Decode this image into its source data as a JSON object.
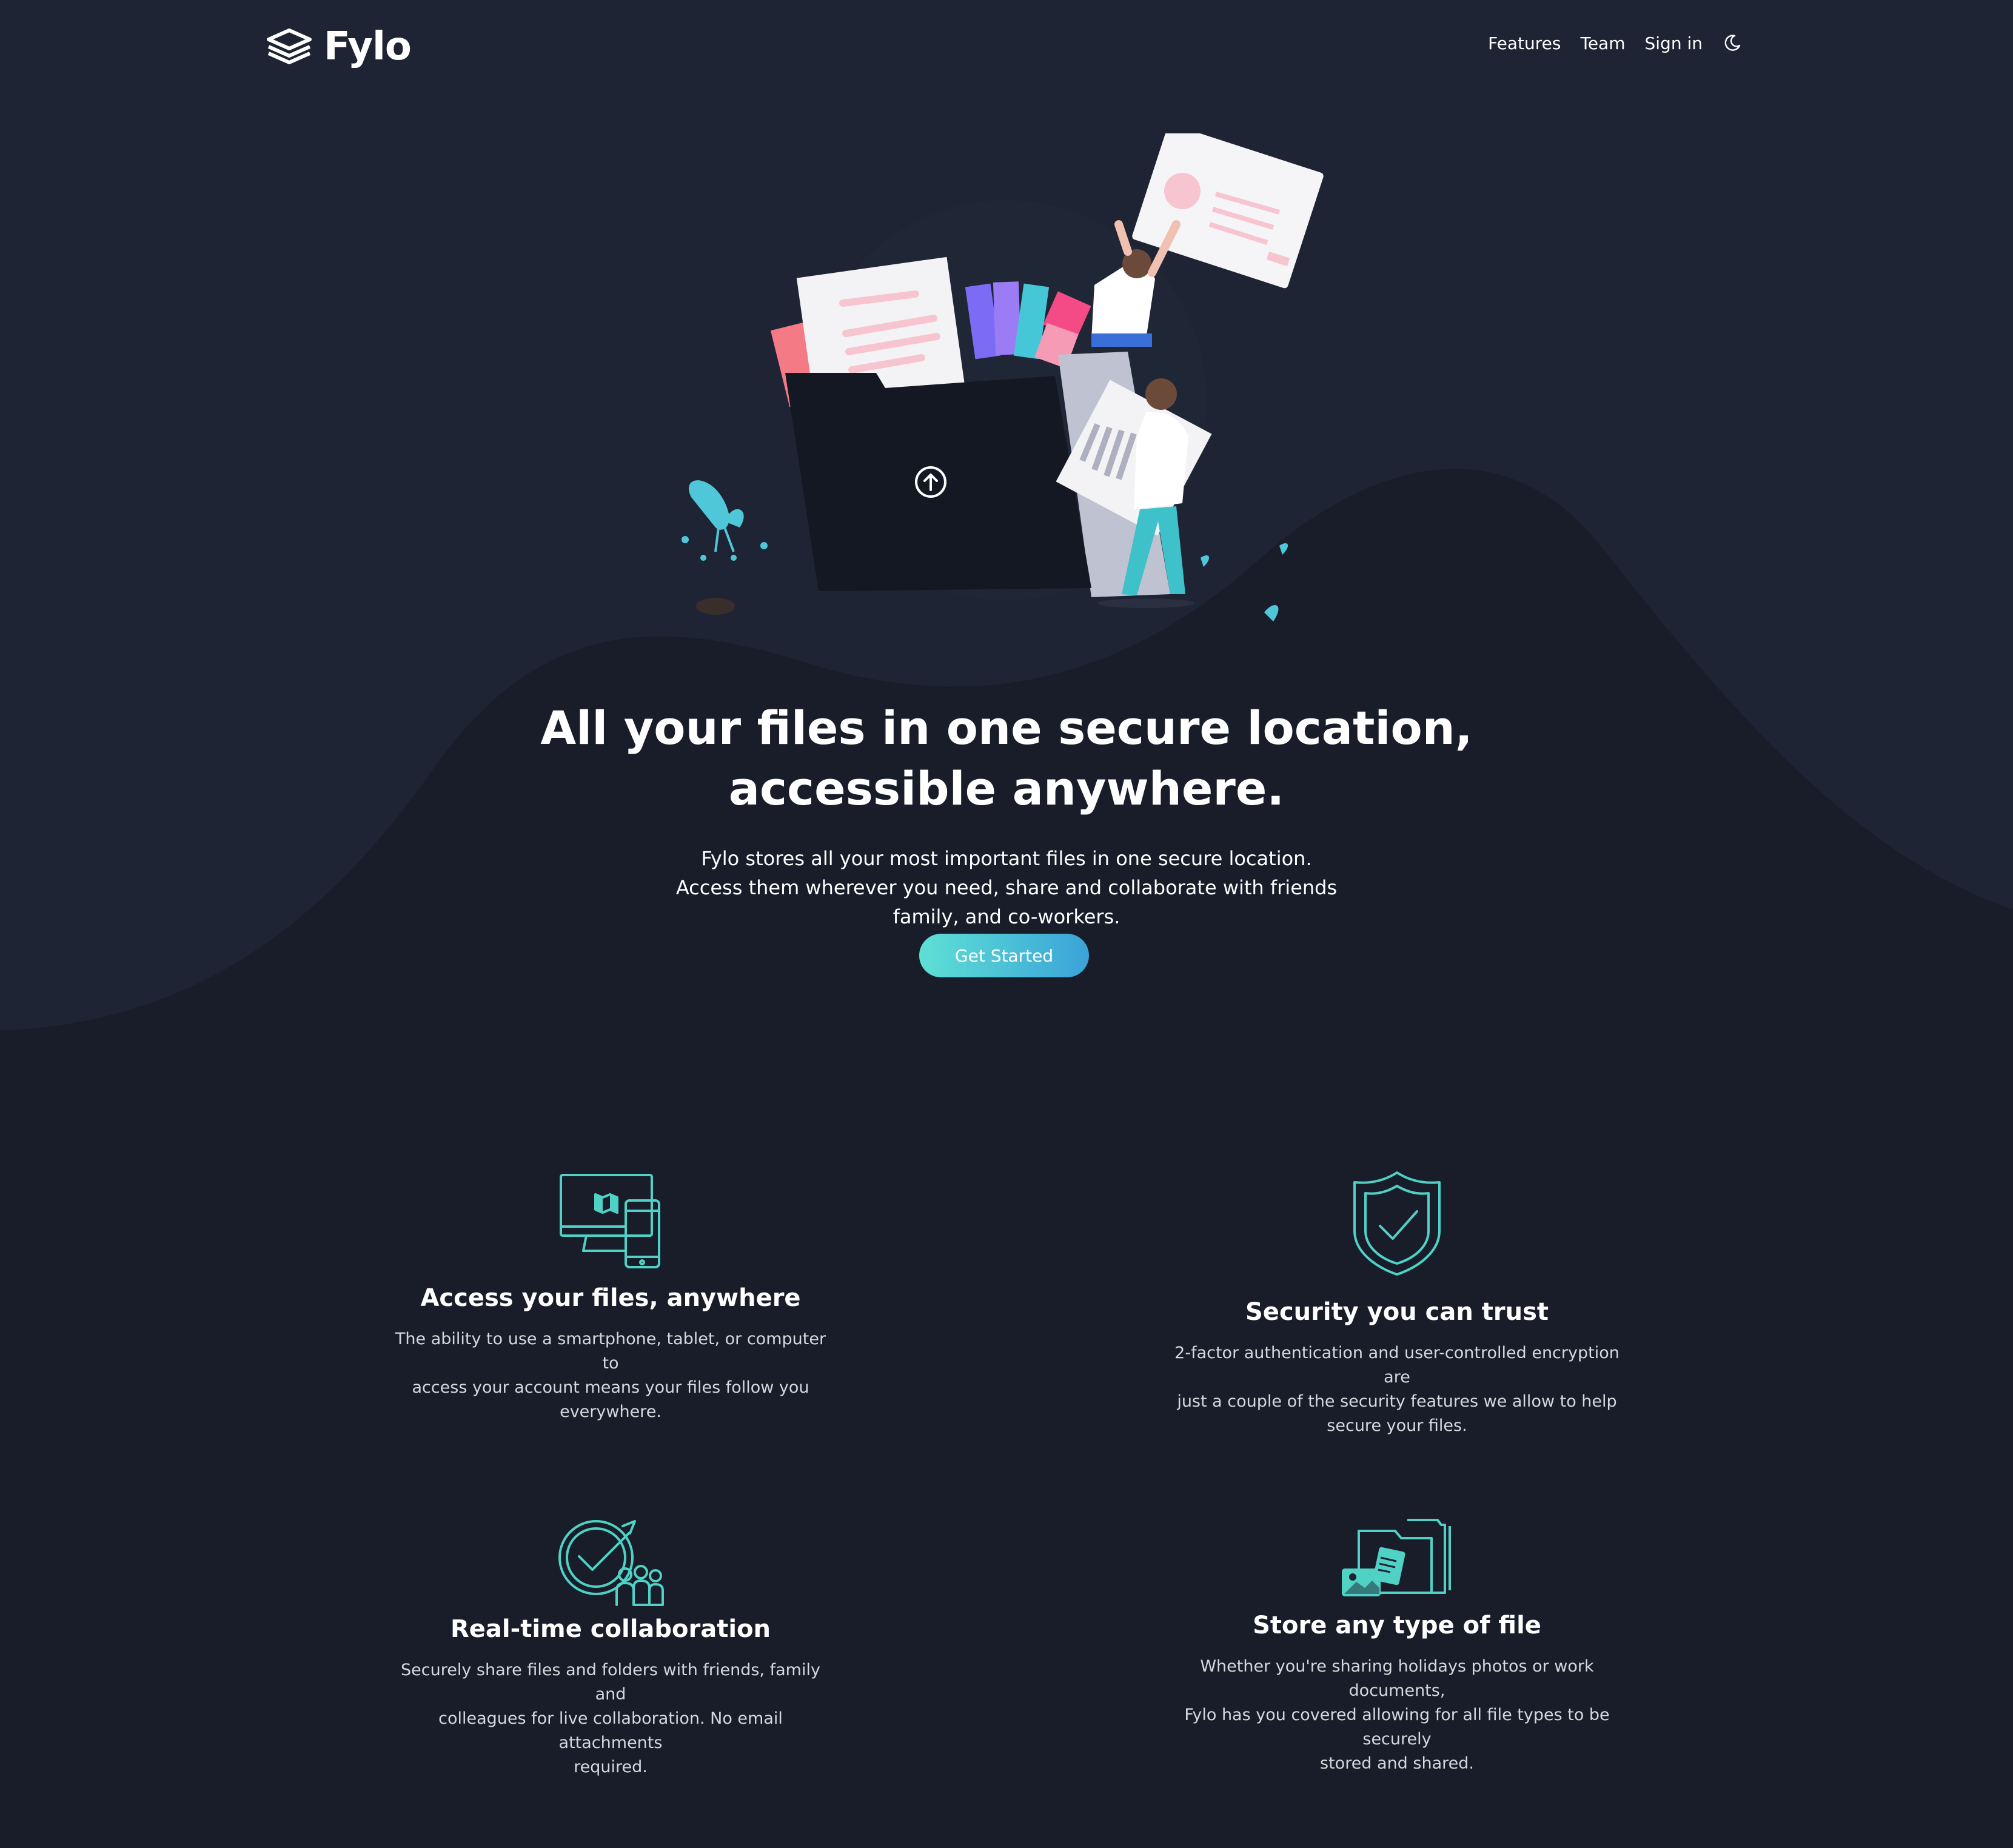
{
  "header": {
    "logo": "Fylo",
    "nav": [
      "Features",
      "Team",
      "Sign in"
    ],
    "theme_toggle_icon": "moon-icon"
  },
  "hero": {
    "title_lines": [
      "All your files in one secure location,",
      "accessible anywhere."
    ],
    "text_lines": [
      "Fylo stores all your most important files in one secure location.",
      "Access them wherever you need, share and collaborate with friends",
      "family, and co-workers."
    ],
    "cta": "Get Started",
    "illustration": "files-folder-illustration"
  },
  "features": [
    {
      "icon": "devices-icon",
      "title": "Access your files, anywhere",
      "text_lines": [
        "The ability to use a smartphone, tablet, or computer to",
        "access your account means your files follow you",
        "everywhere."
      ]
    },
    {
      "icon": "shield-check-icon",
      "title": "Security you can trust",
      "text_lines": [
        "2-factor authentication and user-controlled encryption are",
        "just a couple of the security features we allow to help",
        "secure your files."
      ]
    },
    {
      "icon": "collaboration-icon",
      "title": "Real-time collaboration",
      "text_lines": [
        "Securely share files and folders with friends, family and",
        "colleagues for live collaboration. No email attachments",
        "required."
      ]
    },
    {
      "icon": "file-types-icon",
      "title": "Store any type of file",
      "text_lines": [
        "Whether you're sharing holidays photos or work documents,",
        "Fylo has you covered allowing for all file types to be securely",
        "stored and shared."
      ]
    }
  ],
  "colors": {
    "background_top": "#1e2433",
    "background_bottom": "#181d29",
    "accent_start": "#5ee0d5",
    "accent_end": "#3aa3d8",
    "icon_stroke": "#4fd1c5"
  }
}
